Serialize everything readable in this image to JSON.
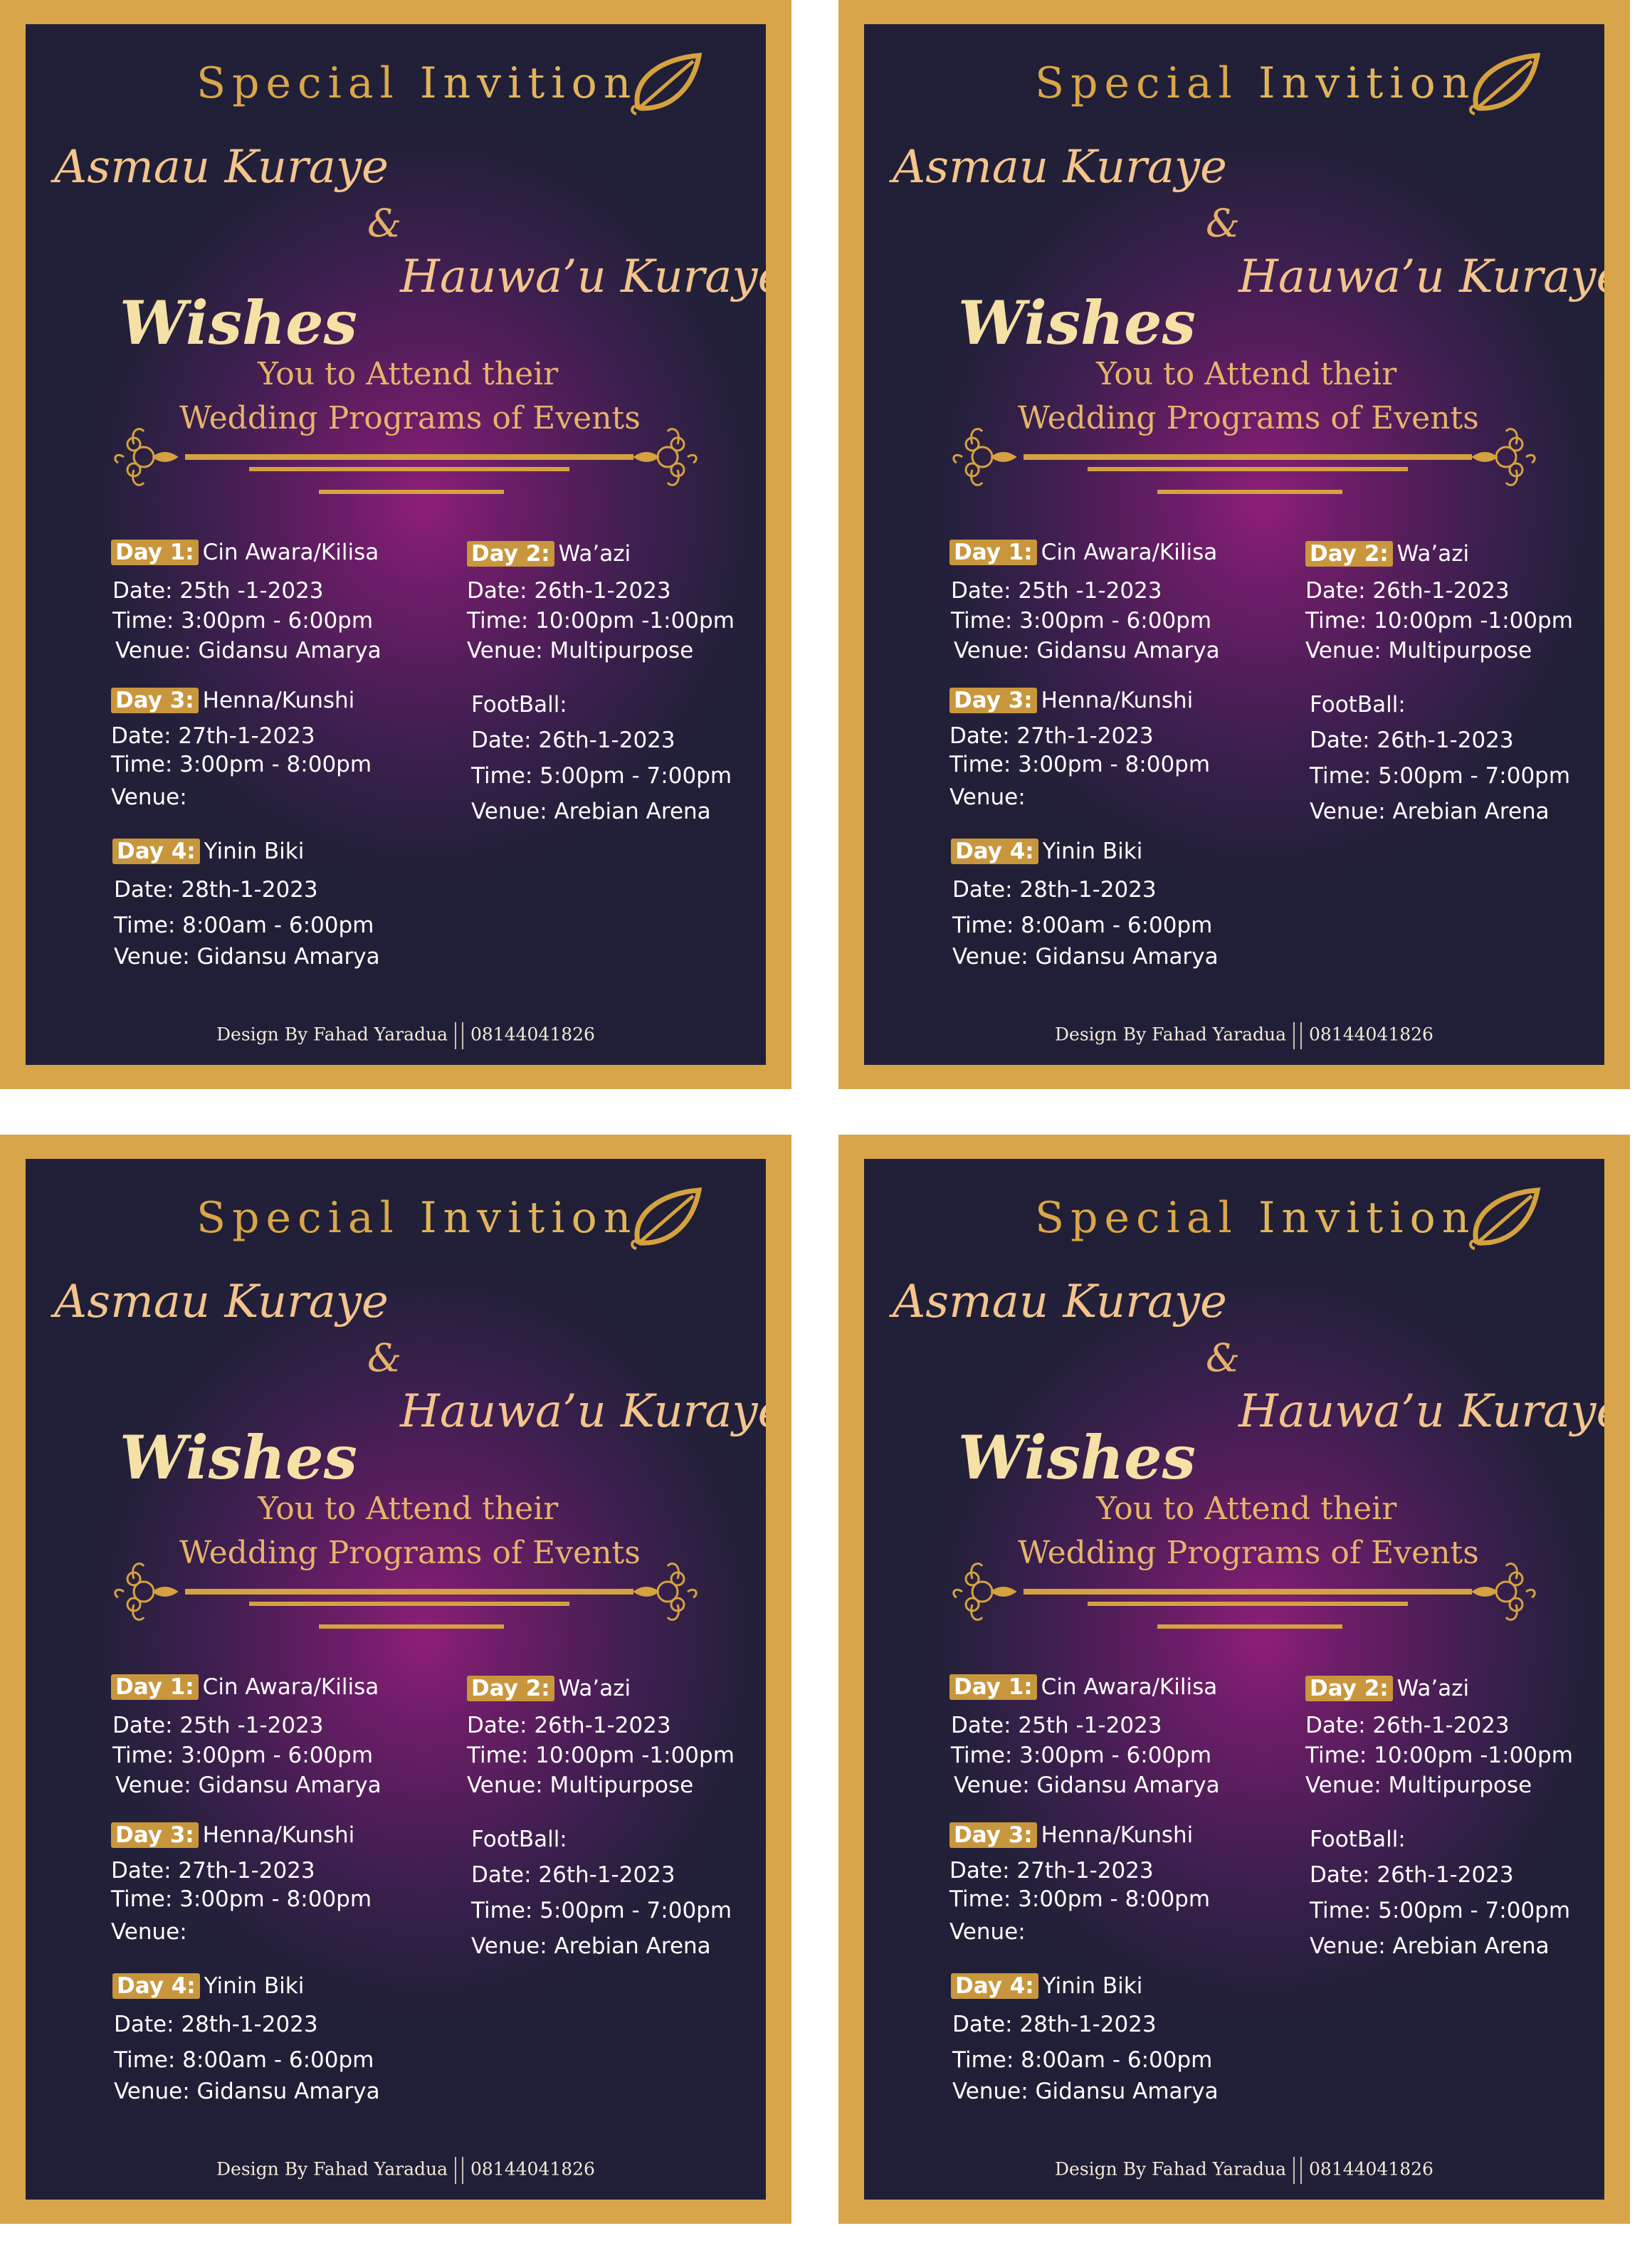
{
  "invitation": {
    "header_word1": "Special",
    "header_word2": "Invition",
    "name1": "Asmau Kuraye",
    "ampersand": "&",
    "name2": "Hauwa’u Kuraye",
    "wishes": "Wishes",
    "subtitle1": "You to Attend their",
    "subtitle2": "Wedding Programs of Events",
    "day1": {
      "badge": "Day 1:",
      "title": "Cin Awara/Kilisa",
      "date": "Date: 25th -1-2023",
      "time": "Time: 3:00pm - 6:00pm",
      "venue": "Venue: Gidansu Amarya"
    },
    "day2": {
      "badge": "Day 2:",
      "title": "Wa’azi",
      "date": "Date: 26th-1-2023",
      "time": "Time: 10:00pm -1:00pm",
      "venue": "Venue: Multipurpose"
    },
    "day3": {
      "badge": "Day 3:",
      "title": "Henna/Kunshi",
      "date": "Date: 27th-1-2023",
      "time": "Time: 3:00pm - 8:00pm",
      "venue": "Venue:"
    },
    "football": {
      "title": "FootBall:",
      "date": "Date: 26th-1-2023",
      "time": "Time: 5:00pm - 7:00pm",
      "venue": "Venue: Arebian Arena"
    },
    "day4": {
      "badge": "Day 4:",
      "title": "Yinin Biki",
      "date": "Date: 28th-1-2023",
      "time": "Time: 8:00am - 6:00pm",
      "venue": "Venue: Gidansu Amarya"
    },
    "footer_designer": "Design By Fahad Yaradua",
    "footer_phone": "08144041826"
  },
  "colors": {
    "gold_frame": "#d8a54a",
    "background_dark": "#211f37",
    "background_glow": "#8d1f78",
    "gold_text": "#d5a23f",
    "cream_text": "#f5e1a6"
  }
}
